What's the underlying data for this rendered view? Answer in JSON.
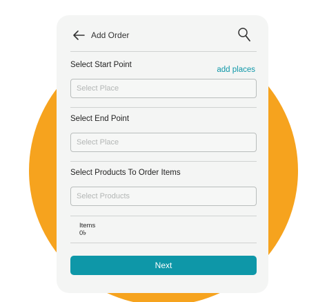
{
  "colors": {
    "accent": "#0e97a8",
    "background_circle": "#f6a31e",
    "card": "#f4f5f4"
  },
  "header": {
    "title": "Add Order",
    "back_icon": "arrow-left-icon",
    "search_icon": "search-icon"
  },
  "start": {
    "label": "Select Start Point",
    "add_link": "add places",
    "placeholder": "Select Place"
  },
  "end": {
    "label": "Select End Point",
    "placeholder": "Select Place"
  },
  "products": {
    "label": "Select Products To Order Items",
    "placeholder": "Select Products"
  },
  "items": {
    "label": "Items",
    "value": "0৳"
  },
  "footer": {
    "next_label": "Next"
  }
}
